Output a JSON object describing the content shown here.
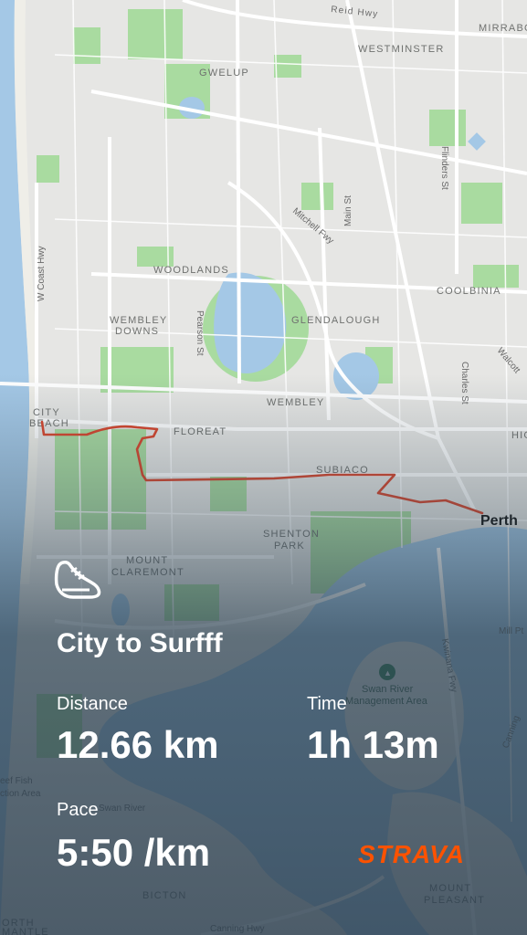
{
  "map": {
    "places": {
      "reid_hwy": "Reid Hwy",
      "mirrabooka": "MIRRABO",
      "westminster": "WESTMINSTER",
      "gwelup": "GWELUP",
      "flinders_st": "Flinders St",
      "mitchell_fwy": "Mitchell Fwy",
      "main_st": "Main St",
      "w_coast_hwy": "W Coast Hwy",
      "woodlands": "WOODLANDS",
      "coolbinia": "COOLBINIA",
      "wembley_downs_1": "WEMBLEY",
      "wembley_downs_2": "DOWNS",
      "pearson_st": "Pearson St",
      "glendalough": "GLENDALOUGH",
      "walcott": "Walcott",
      "charles_st": "Charles St",
      "wembley": "WEMBLEY",
      "city_beach_1": "CITY",
      "city_beach_2": "BEACH",
      "floreat": "FLOREAT",
      "subiaco": "SUBIACO",
      "perth": "Perth",
      "shenton_park_1": "SHENTON",
      "shenton_park_2": "PARK",
      "mount_claremont_1": "MOUNT",
      "mount_claremont_2": "CLAREMONT",
      "mill_pt": "Mill Pt",
      "kwinana_fwy": "Kwinana Fwy",
      "swan_river_ma_1": "Swan River",
      "swan_river_ma_2": "Management Area",
      "canning": "Canning",
      "reef_fish_1": "eef Fish",
      "reef_fish_2": "ction Area",
      "swan_river": "Swan River",
      "bicton": "BICTON",
      "mount_pleasant_1": "MOUNT",
      "mount_pleasant_2": "PLEASANT",
      "canning_hwy": "Canning Hwy",
      "north_1": "ORTH",
      "north_2": "MANTLE",
      "high": "HIG"
    }
  },
  "activity": {
    "icon": "running-shoe-icon",
    "title": "City to Surfff",
    "distance_label": "Distance",
    "distance_value": "12.66 km",
    "time_label": "Time",
    "time_value": "1h 13m",
    "pace_label": "Pace",
    "pace_value": "5:50 /km"
  },
  "brand": {
    "logo_text": "STRAVA",
    "color": "#fc5200"
  },
  "colors": {
    "route": "#d8452c",
    "water": "#a4c8e6",
    "park": "#a9dba0",
    "land": "#e6e6e4"
  }
}
